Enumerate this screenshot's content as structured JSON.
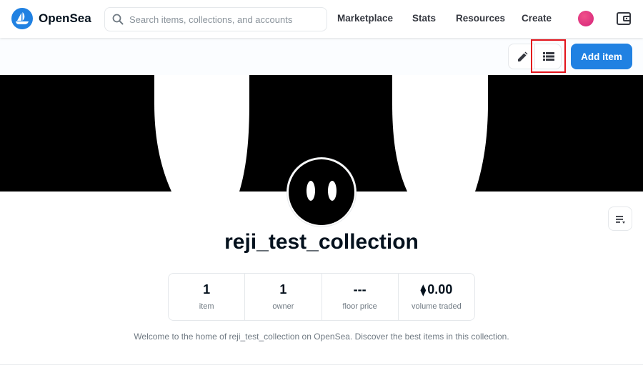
{
  "header": {
    "brand": "OpenSea",
    "search_placeholder": "Search items, collections, and accounts",
    "nav": [
      "Marketplace",
      "Stats",
      "Resources",
      "Create"
    ]
  },
  "toolbar": {
    "add_item_label": "Add item",
    "highlight_color": "#e3131b"
  },
  "collection": {
    "name": "reji_test_collection",
    "description": "Welcome to the home of reji_test_collection on OpenSea. Discover the best items in this collection.",
    "stats": [
      {
        "value": "1",
        "label": "item"
      },
      {
        "value": "1",
        "label": "owner"
      },
      {
        "value": "---",
        "label": "floor price"
      },
      {
        "value": "0.00",
        "label": "volume traded",
        "currency_symbol": "⧫"
      }
    ]
  },
  "colors": {
    "brand_blue": "#2081e2",
    "text_dark": "#04111d",
    "text_muted": "#707a83",
    "border": "#e5e8eb"
  }
}
